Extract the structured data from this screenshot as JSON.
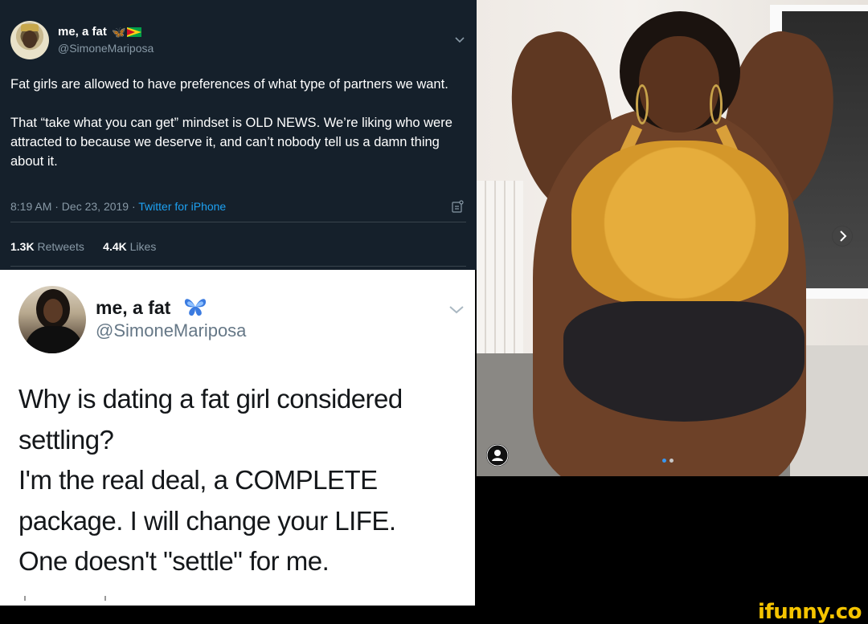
{
  "dark_tweet": {
    "display_name": "me, a fat",
    "emoji": "🦋",
    "handle": "@SimoneMariposa",
    "paragraphs": [
      "Fat girls are allowed to have preferences of what type of partners we want.",
      "That “take what you can get” mindset is OLD NEWS. We’re liking who were attracted to because we deserve it, and can’t nobody tell us a damn thing about it."
    ],
    "time": "8:19 AM · Dec 23, 2019 · ",
    "source": "Twitter for iPhone",
    "retweets_count": "1.3K",
    "retweets_label": "Retweets",
    "likes_count": "4.4K",
    "likes_label": "Likes",
    "colors": {
      "background": "#15202b",
      "link": "#1da1f2",
      "muted": "#8899a6"
    }
  },
  "light_tweet": {
    "display_name": "me, a fat",
    "emoji": "🦋",
    "handle": "@SimoneMariposa",
    "lines": [
      "Why is dating a fat girl considered",
      "settling?",
      "I'm the real deal, a COMPLETE",
      "package. I will change your LIFE.",
      "One doesn't \"settle\" for me."
    ]
  },
  "photo": {
    "carousel_next_icon": "chevron-right-icon",
    "user_tag_icon": "user-icon",
    "carousel_dots": 2,
    "active_dot": 1
  },
  "watermark": {
    "text": "ifunny.co",
    "color": "#f5c400"
  }
}
